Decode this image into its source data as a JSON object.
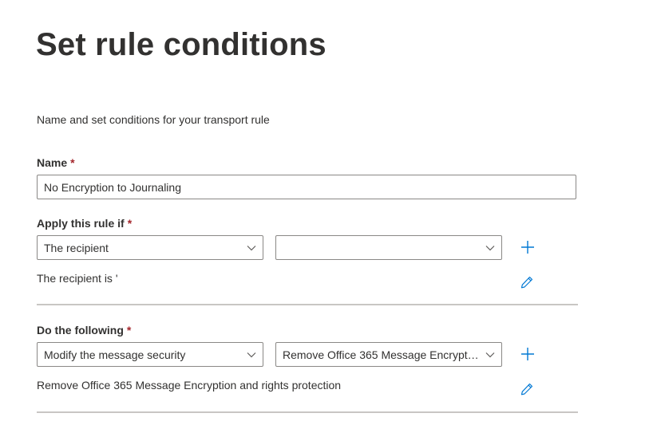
{
  "page": {
    "title": "Set rule conditions",
    "description": "Name and set conditions for your transport rule"
  },
  "name_field": {
    "label": "Name",
    "required_marker": "*",
    "value": "No Encryption to Journaling"
  },
  "apply_rule": {
    "label": "Apply this rule if",
    "required_marker": "*",
    "condition_dropdown": "The recipient",
    "value_dropdown": "",
    "summary": "The recipient is '"
  },
  "do_following": {
    "label": "Do the following",
    "required_marker": "*",
    "action_dropdown": "Modify the message security",
    "value_dropdown": "Remove Office 365 Message Encryption and rights protection",
    "summary": "Remove Office 365 Message Encryption and rights protection"
  },
  "icons": {
    "add": "plus-icon",
    "edit": "pencil-icon",
    "dropdown": "chevron-down-icon"
  },
  "colors": {
    "accent": "#0078d4",
    "required": "#a4262c",
    "text": "#323130",
    "border": "#8a8886",
    "divider": "#c8c6c4"
  }
}
